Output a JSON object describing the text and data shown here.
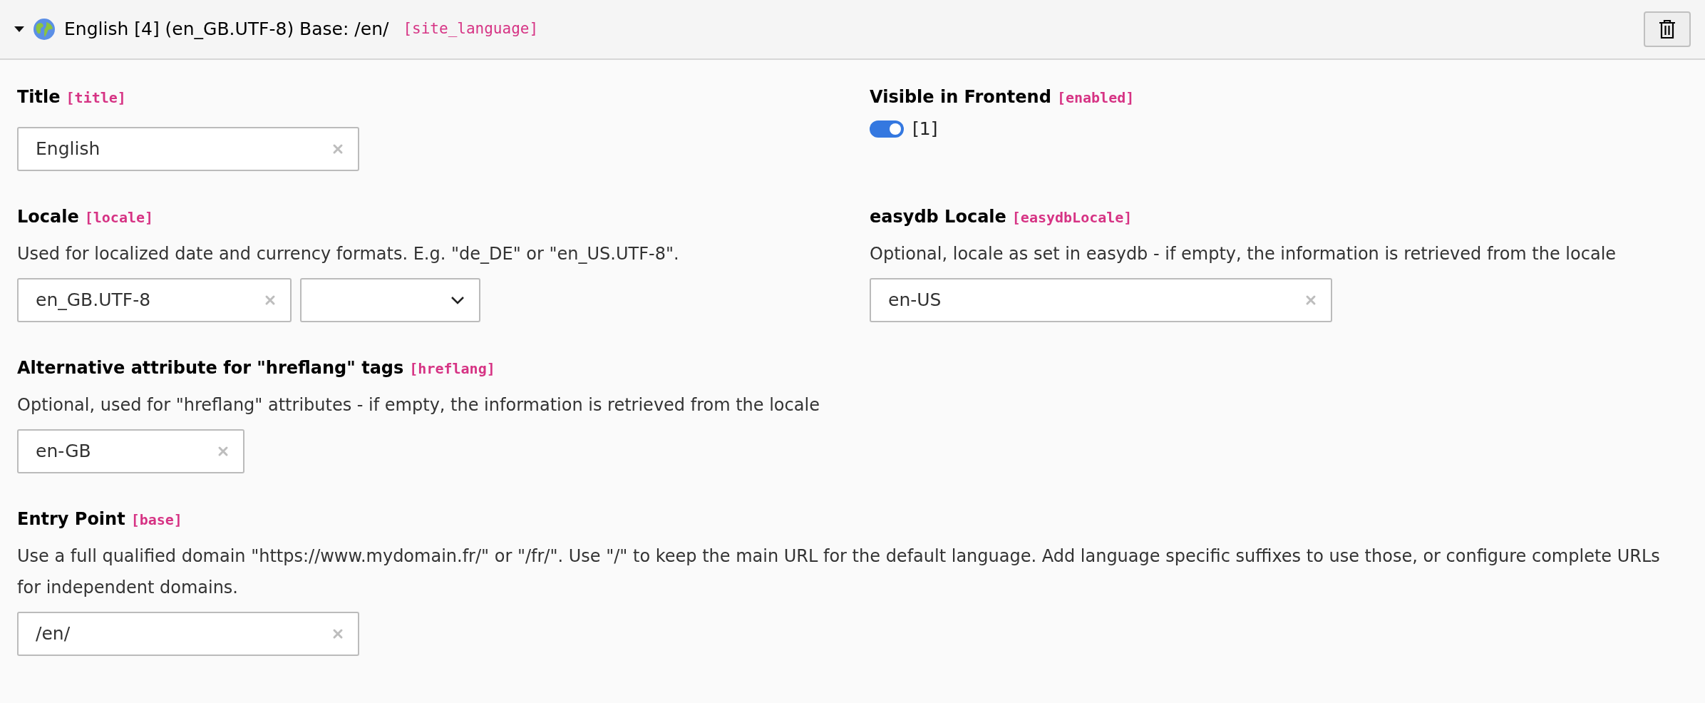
{
  "header": {
    "expanded": true,
    "title": "English [4] (en_GB.UTF-8) Base: /en/",
    "field_name": "[site_language]"
  },
  "rows": [
    [
      {
        "kind": "text",
        "label": "Title",
        "field_name": "[title]",
        "value": "English"
      },
      {
        "kind": "toggle",
        "label": "Visible in Frontend",
        "field_name": "[enabled]",
        "on": true,
        "value": "[1]"
      }
    ],
    [
      {
        "kind": "text_select",
        "label": "Locale",
        "field_name": "[locale]",
        "description": "Used for localized date and currency formats. E.g. \"de_DE\" or \"en_US.UTF-8\".",
        "value": "en_GB.UTF-8"
      },
      {
        "kind": "text",
        "label": "easydb Locale",
        "field_name": "[easydbLocale]",
        "description": "Optional, locale as set in easydb - if empty, the information is retrieved from the locale",
        "value": "en-US"
      }
    ],
    [
      {
        "kind": "text",
        "label": "Alternative attribute for \"hreflang\" tags",
        "field_name": "[hreflang]",
        "description": "Optional, used for \"hreflang\" attributes - if empty, the information is retrieved from the locale",
        "value": "en-GB"
      }
    ],
    [
      {
        "kind": "text",
        "label": "Entry Point",
        "field_name": "[base]",
        "description": "Use a full qualified domain \"https://www.mydomain.fr/\" or \"/fr/\". Use \"/\" to keep the main URL for the default language. Add language specific suffixes to use those, or configure complete URLs for independent domains.",
        "value": "/en/"
      }
    ]
  ]
}
